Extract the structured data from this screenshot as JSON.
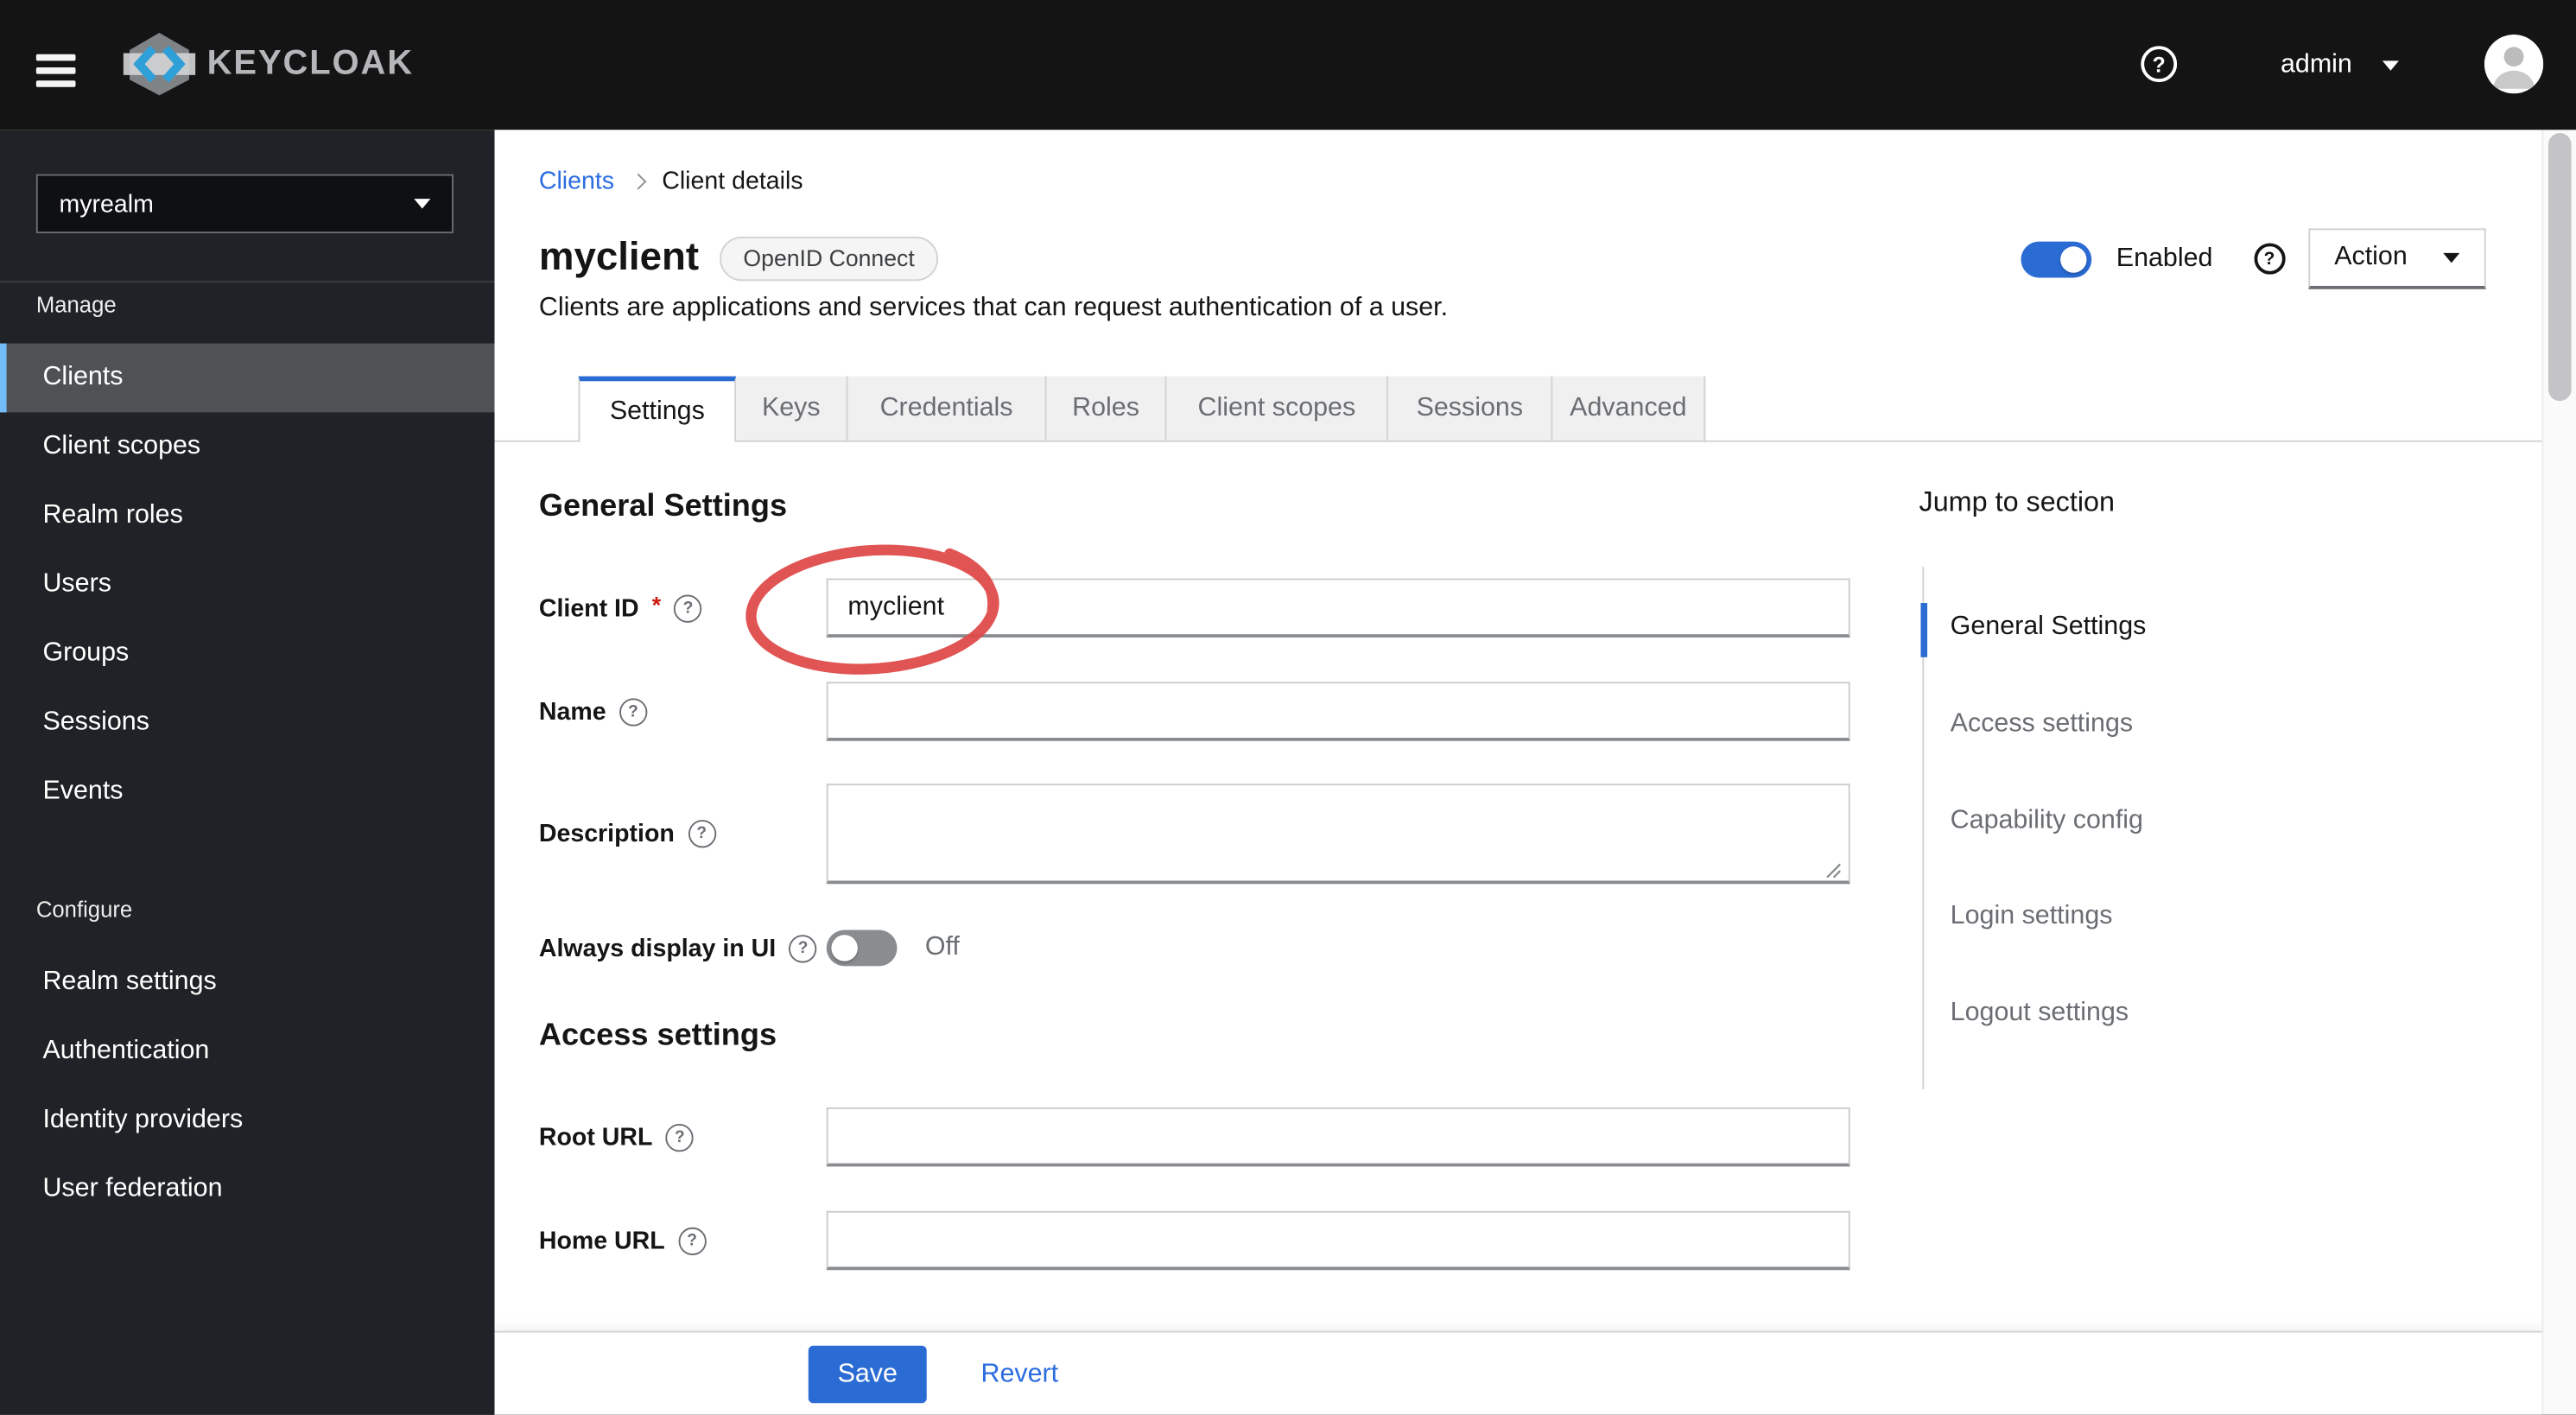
{
  "header": {
    "brand": "KEYCLOAK",
    "user": "admin"
  },
  "sidebar": {
    "realm": "myrealm",
    "sections": [
      {
        "label": "Manage",
        "active_item": "Clients",
        "items": [
          "Clients",
          "Client scopes",
          "Realm roles",
          "Users",
          "Groups",
          "Sessions",
          "Events"
        ]
      },
      {
        "label": "Configure",
        "items": [
          "Realm settings",
          "Authentication",
          "Identity providers",
          "User federation"
        ]
      }
    ]
  },
  "breadcrumb": {
    "link": "Clients",
    "current": "Client details"
  },
  "client": {
    "title": "myclient",
    "protocol_badge": "OpenID Connect",
    "description": "Clients are applications and services that can request authentication of a user.",
    "enabled_label": "Enabled",
    "enabled_state": "on",
    "action_label": "Action"
  },
  "tabs": {
    "active": "Settings",
    "items": [
      "Settings",
      "Keys",
      "Credentials",
      "Roles",
      "Client scopes",
      "Sessions",
      "Advanced"
    ]
  },
  "form": {
    "general_heading": "General Settings",
    "access_heading": "Access settings",
    "client_id": {
      "label": "Client ID",
      "required_indicator": "*",
      "value": "myclient"
    },
    "name": {
      "label": "Name",
      "value": ""
    },
    "description": {
      "label": "Description",
      "value": ""
    },
    "always_display": {
      "label": "Always display in UI",
      "state": "off",
      "state_label": "Off"
    },
    "root_url": {
      "label": "Root URL",
      "value": ""
    },
    "home_url": {
      "label": "Home URL",
      "value": ""
    }
  },
  "jump": {
    "heading": "Jump to section",
    "active": "General Settings",
    "items": [
      "General Settings",
      "Access settings",
      "Capability config",
      "Login settings",
      "Logout settings"
    ]
  },
  "footer": {
    "save": "Save",
    "revert": "Revert"
  },
  "annotation": {
    "shape": "hand-drawn-circle",
    "target": "client-id-input",
    "color": "#e04b4b"
  },
  "colors": {
    "primary": "#2b6cd4",
    "link": "#2b6ce0",
    "nav_active_indicator": "#73bcf7",
    "masthead_bg": "#141414",
    "sidebar_bg": "#1f2226",
    "tab_inactive_bg": "#f0f0f0"
  }
}
